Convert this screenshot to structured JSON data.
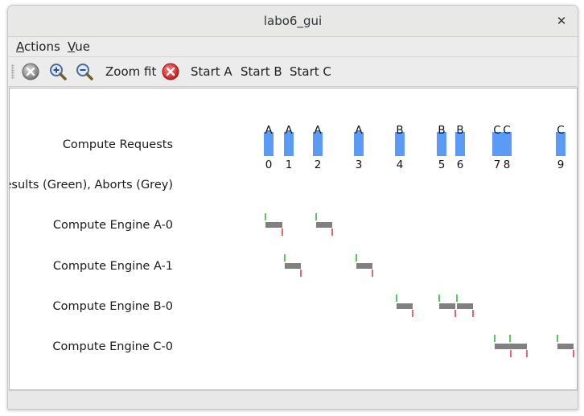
{
  "window": {
    "title": "labo6_gui"
  },
  "menubar": {
    "items": [
      {
        "mnemonic": "A",
        "rest": "ctions"
      },
      {
        "mnemonic": "V",
        "rest": "ue"
      }
    ]
  },
  "toolbar": {
    "zoom_fit_label": "Zoom fit",
    "start_a_label": "Start A",
    "start_b_label": "Start B",
    "start_c_label": "Start C",
    "icons": [
      "stop-icon",
      "zoom-in-icon",
      "zoom-out-icon",
      "cancel-icon"
    ]
  },
  "timeline": {
    "rows": [
      "Compute Requests",
      "Results (Green), Aborts (Grey)",
      "Compute Engine A-0",
      "Compute Engine A-1",
      "Compute Engine B-0",
      "Compute Engine C-0"
    ],
    "colors": {
      "request": "#5b9bf5",
      "busy": "#808080",
      "start_tick": "#5cc85c",
      "end_tick": "#ef6464"
    },
    "requests": [
      {
        "id": "0",
        "engine": "A"
      },
      {
        "id": "1",
        "engine": "A"
      },
      {
        "id": "2",
        "engine": "A"
      },
      {
        "id": "3",
        "engine": "A"
      },
      {
        "id": "4",
        "engine": "B"
      },
      {
        "id": "5",
        "engine": "B"
      },
      {
        "id": "6",
        "engine": "B"
      },
      {
        "id": "7",
        "engine": "C"
      },
      {
        "id": "8",
        "engine": "C"
      },
      {
        "id": "9",
        "engine": "C"
      }
    ]
  }
}
